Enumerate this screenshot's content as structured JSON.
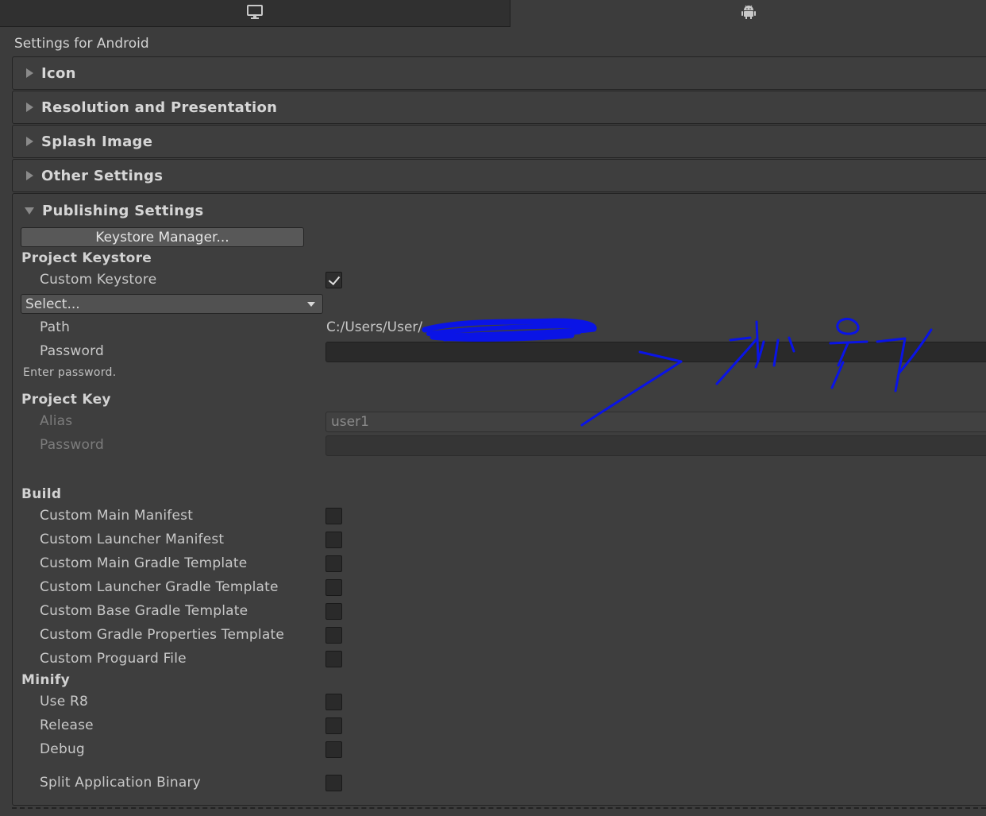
{
  "tabs": [
    {
      "name": "standalone",
      "icon": "monitor-icon",
      "selected": false
    },
    {
      "name": "android",
      "icon": "android-icon",
      "selected": true
    }
  ],
  "panel_title": "Settings for Android",
  "foldouts": {
    "icon": "Icon",
    "resolution": "Resolution and Presentation",
    "splash": "Splash Image",
    "other": "Other Settings",
    "publishing": "Publishing Settings"
  },
  "publishing": {
    "keystore_manager_button": "Keystore Manager...",
    "project_keystore": {
      "heading": "Project Keystore",
      "custom_keystore_label": "Custom Keystore",
      "custom_keystore_checked": true,
      "select_value": "Select...",
      "path_label": "Path",
      "path_value": "C:/Users/User/",
      "password_label": "Password",
      "help_text": "Enter password."
    },
    "project_key": {
      "heading": "Project Key",
      "alias_label": "Alias",
      "alias_value": "user1",
      "password_label": "Password"
    },
    "build": {
      "heading": "Build",
      "options": [
        {
          "label": "Custom Main Manifest",
          "checked": false
        },
        {
          "label": "Custom Launcher Manifest",
          "checked": false
        },
        {
          "label": "Custom Main Gradle Template",
          "checked": false
        },
        {
          "label": "Custom Launcher Gradle Template",
          "checked": false
        },
        {
          "label": "Custom Base Gradle Template",
          "checked": false
        },
        {
          "label": "Custom Gradle Properties Template",
          "checked": false
        },
        {
          "label": "Custom Proguard File",
          "checked": false
        }
      ]
    },
    "minify": {
      "heading": "Minify",
      "options": [
        {
          "label": "Use R8",
          "checked": false
        },
        {
          "label": "Release",
          "checked": false
        },
        {
          "label": "Debug",
          "checked": false
        }
      ]
    },
    "split_application_binary": {
      "label": "Split Application Binary",
      "checked": false
    }
  },
  "annotation": {
    "color": "#0a14e6",
    "text": "채우기"
  }
}
